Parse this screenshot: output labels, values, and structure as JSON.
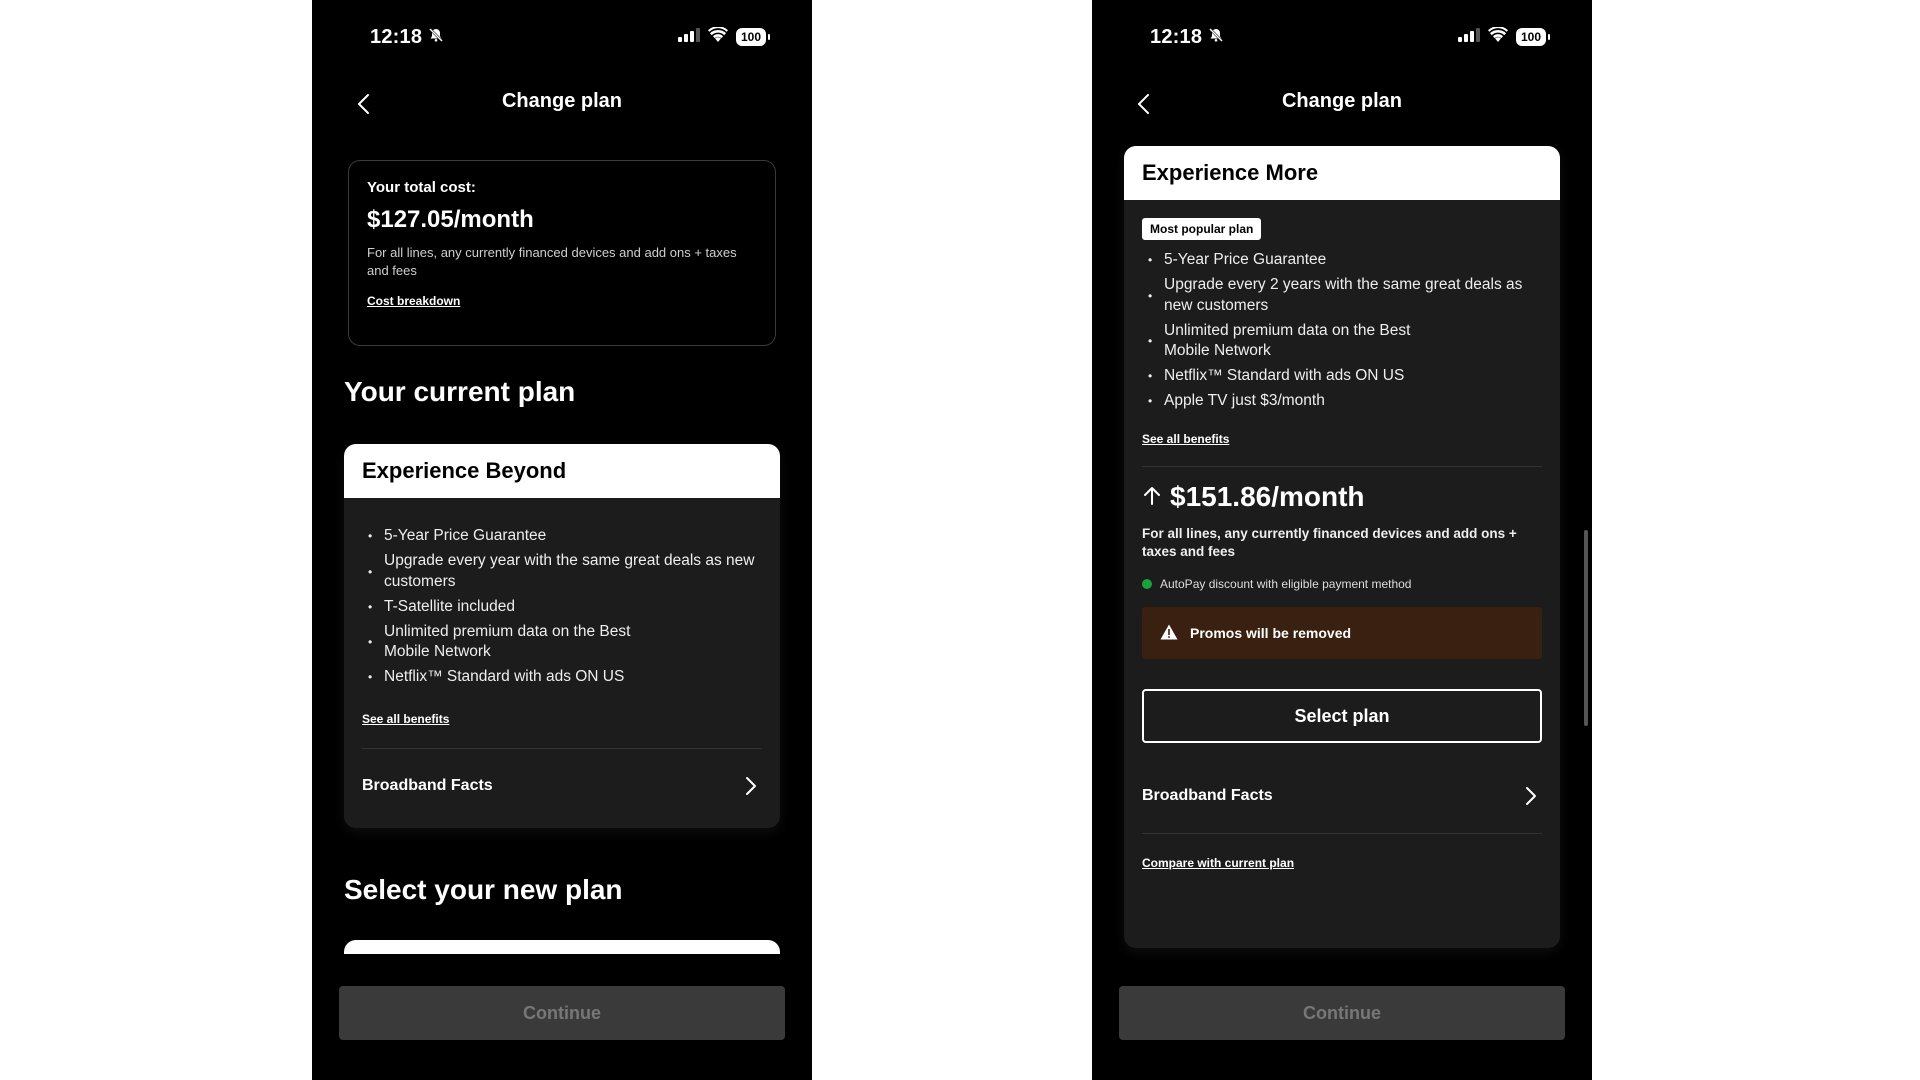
{
  "left": {
    "status": {
      "time": "12:18",
      "battery": "100"
    },
    "nav_title": "Change plan",
    "total_cost": {
      "label": "Your total cost:",
      "amount": "$127.05/month",
      "desc": "For all lines, any currently financed devices and add ons + taxes and fees",
      "link": "Cost breakdown"
    },
    "current_plan_title": "Your current plan",
    "current_plan": {
      "name": "Experience Beyond",
      "benefits": [
        "5-Year Price Guarantee",
        "Upgrade every year with the same great deals as new customers",
        "T-Satellite included",
        "Unlimited premium data on the Best Mobile Network",
        "Netflix™ Standard with ads ON US"
      ],
      "see_all": "See all benefits",
      "broadband": "Broadband Facts"
    },
    "new_plan_title": "Select your new plan",
    "continue": "Continue"
  },
  "right": {
    "status": {
      "time": "12:18",
      "battery": "100"
    },
    "nav_title": "Change plan",
    "plan": {
      "name": "Experience More",
      "badge": "Most popular plan",
      "benefits": [
        "5-Year Price Guarantee",
        "Upgrade every 2 years with the same great deals as new customers",
        "Unlimited premium data on the Best Mobile Network",
        "Netflix™ Standard with ads ON US",
        "Apple TV just $3/month"
      ],
      "see_all": "See all benefits",
      "price": "$151.86/month",
      "price_desc": "For all lines, any currently financed devices and add ons + taxes and fees",
      "autopay": "AutoPay discount with eligible payment method",
      "promo": "Promos will be removed",
      "select": "Select plan",
      "broadband": "Broadband Facts",
      "compare": "Compare with current plan"
    },
    "continue": "Continue"
  }
}
